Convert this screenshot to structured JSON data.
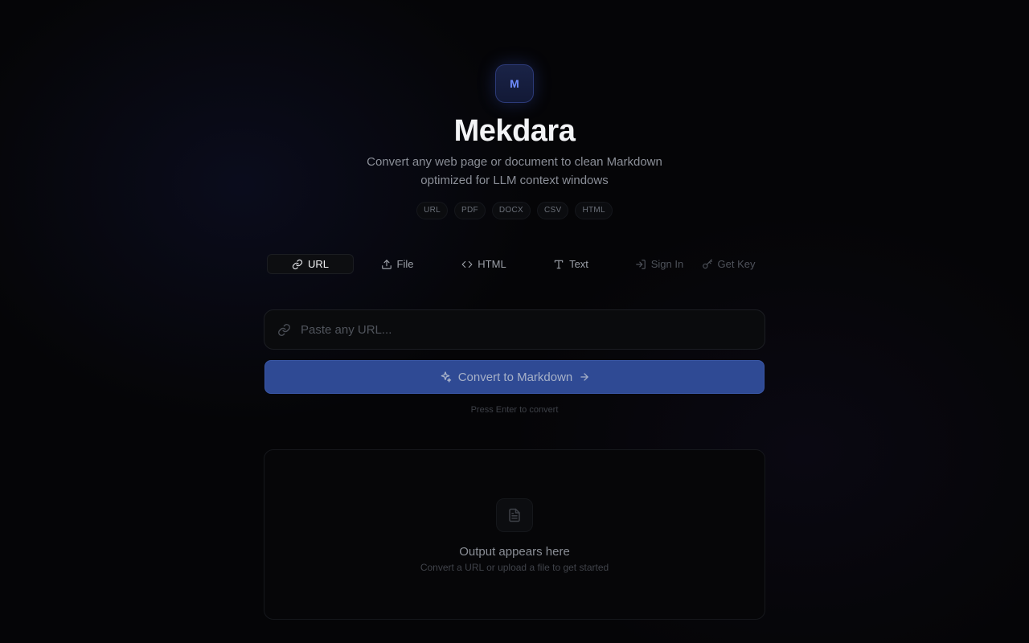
{
  "brand": {
    "logo_letter": "M",
    "title": "Mekdara",
    "subtitle_line1": "Convert any web page or document to clean Markdown",
    "subtitle_line2": "optimized for LLM context windows",
    "accent_color": "#6f8cff"
  },
  "formats": [
    "URL",
    "PDF",
    "DOCX",
    "CSV",
    "HTML"
  ],
  "tabs": [
    {
      "label": "URL",
      "icon": "link-icon",
      "active": true
    },
    {
      "label": "File",
      "icon": "upload-icon",
      "active": false
    },
    {
      "label": "HTML",
      "icon": "code-icon",
      "active": false
    },
    {
      "label": "Text",
      "icon": "text-icon",
      "active": false
    }
  ],
  "auth": {
    "sign_in_label": "Sign In",
    "get_key_label": "Get Key"
  },
  "url_input": {
    "placeholder": "Paste any URL...",
    "value": ""
  },
  "convert_button": {
    "label": "Convert to Markdown",
    "color": "#2f4a94"
  },
  "hint": "Press Enter to convert",
  "output": {
    "title": "Output appears here",
    "subtitle": "Convert a URL or upload a file to get started"
  }
}
